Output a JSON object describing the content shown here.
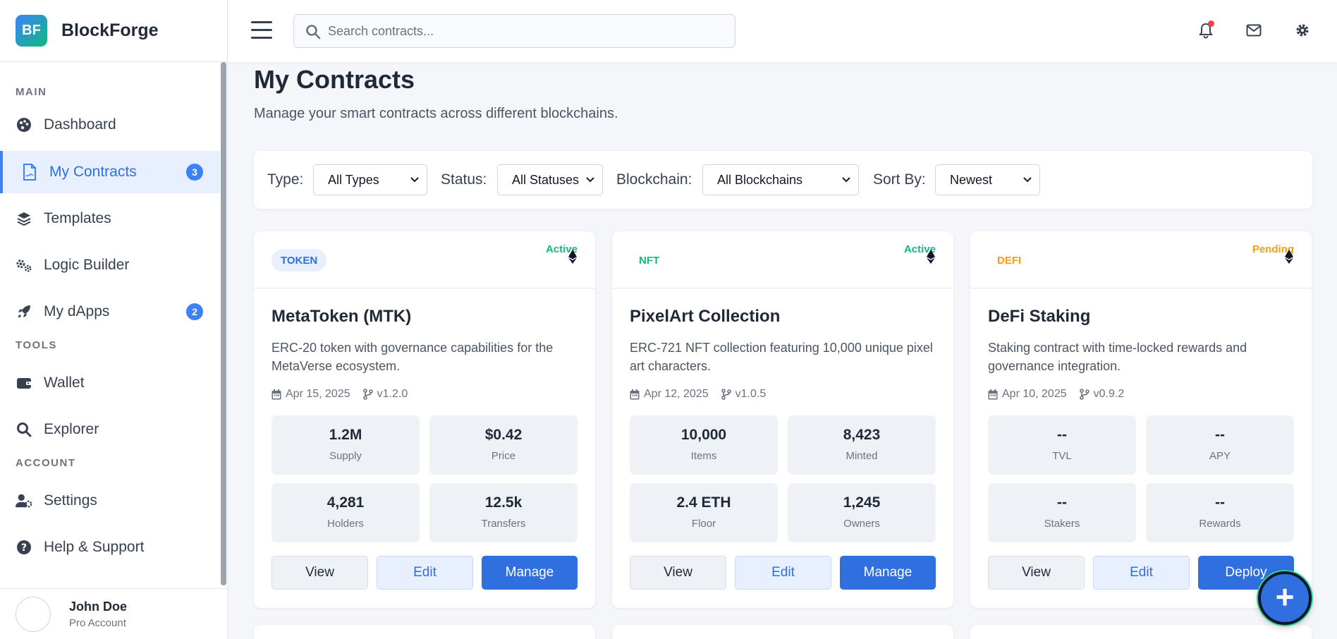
{
  "brand": {
    "logo_text": "BF",
    "name": "BlockForge"
  },
  "sidebar": {
    "sections": {
      "main": "MAIN",
      "tools": "TOOLS",
      "account": "ACCOUNT"
    },
    "items": [
      {
        "label": "Dashboard",
        "icon": "palette-icon"
      },
      {
        "label": "My Contracts",
        "icon": "file-contract-icon",
        "badge": "3",
        "active": true
      },
      {
        "label": "Templates",
        "icon": "layers-icon"
      },
      {
        "label": "Logic Builder",
        "icon": "cogs-icon"
      },
      {
        "label": "My dApps",
        "icon": "rocket-icon",
        "badge": "2"
      },
      {
        "label": "Wallet",
        "icon": "wallet-icon"
      },
      {
        "label": "Explorer",
        "icon": "search-icon"
      },
      {
        "label": "Settings",
        "icon": "user-cog-icon"
      },
      {
        "label": "Help & Support",
        "icon": "help-icon"
      }
    ],
    "user": {
      "name": "John Doe",
      "role": "Pro Account"
    }
  },
  "header": {
    "search_placeholder": "Search contracts..."
  },
  "page": {
    "title": "My Contracts",
    "subtitle": "Manage your smart contracts across different blockchains."
  },
  "filters": {
    "type": {
      "label": "Type:",
      "value": "All Types"
    },
    "status": {
      "label": "Status:",
      "value": "All Statuses"
    },
    "blockchain": {
      "label": "Blockchain:",
      "value": "All Blockchains"
    },
    "sort": {
      "label": "Sort By:",
      "value": "Newest"
    }
  },
  "cards": [
    {
      "type": "TOKEN",
      "status": "Active",
      "title": "MetaToken (MTK)",
      "desc": "ERC-20 token with governance capabilities for the MetaVerse ecosystem.",
      "date": "Apr 15, 2025",
      "version": "v1.2.0",
      "stats": [
        {
          "value": "1.2M",
          "label": "Supply"
        },
        {
          "value": "$0.42",
          "label": "Price"
        },
        {
          "value": "4,281",
          "label": "Holders"
        },
        {
          "value": "12.5k",
          "label": "Transfers"
        }
      ],
      "actions": {
        "view": "View",
        "edit": "Edit",
        "primary": "Manage"
      }
    },
    {
      "type": "NFT",
      "status": "Active",
      "title": "PixelArt Collection",
      "desc": "ERC-721 NFT collection featuring 10,000 unique pixel art characters.",
      "date": "Apr 12, 2025",
      "version": "v1.0.5",
      "stats": [
        {
          "value": "10,000",
          "label": "Items"
        },
        {
          "value": "8,423",
          "label": "Minted"
        },
        {
          "value": "2.4 ETH",
          "label": "Floor"
        },
        {
          "value": "1,245",
          "label": "Owners"
        }
      ],
      "actions": {
        "view": "View",
        "edit": "Edit",
        "primary": "Manage"
      }
    },
    {
      "type": "DEFI",
      "status": "Pending",
      "title": "DeFi Staking",
      "desc": "Staking contract with time-locked rewards and governance integration.",
      "date": "Apr 10, 2025",
      "version": "v0.9.2",
      "stats": [
        {
          "value": "--",
          "label": "TVL"
        },
        {
          "value": "--",
          "label": "APY"
        },
        {
          "value": "--",
          "label": "Stakers"
        },
        {
          "value": "--",
          "label": "Rewards"
        }
      ],
      "actions": {
        "view": "View",
        "edit": "Edit",
        "primary": "Deploy"
      }
    }
  ],
  "fab": {
    "label": "+"
  },
  "colors": {
    "accent": "#2f6fe0",
    "active": "#10b981",
    "pending": "#f59e0b",
    "token_bg": "#e8efff",
    "token_fg": "#2f6fe0",
    "nft_fg": "#10b981",
    "defi_fg": "#f59e0b"
  }
}
